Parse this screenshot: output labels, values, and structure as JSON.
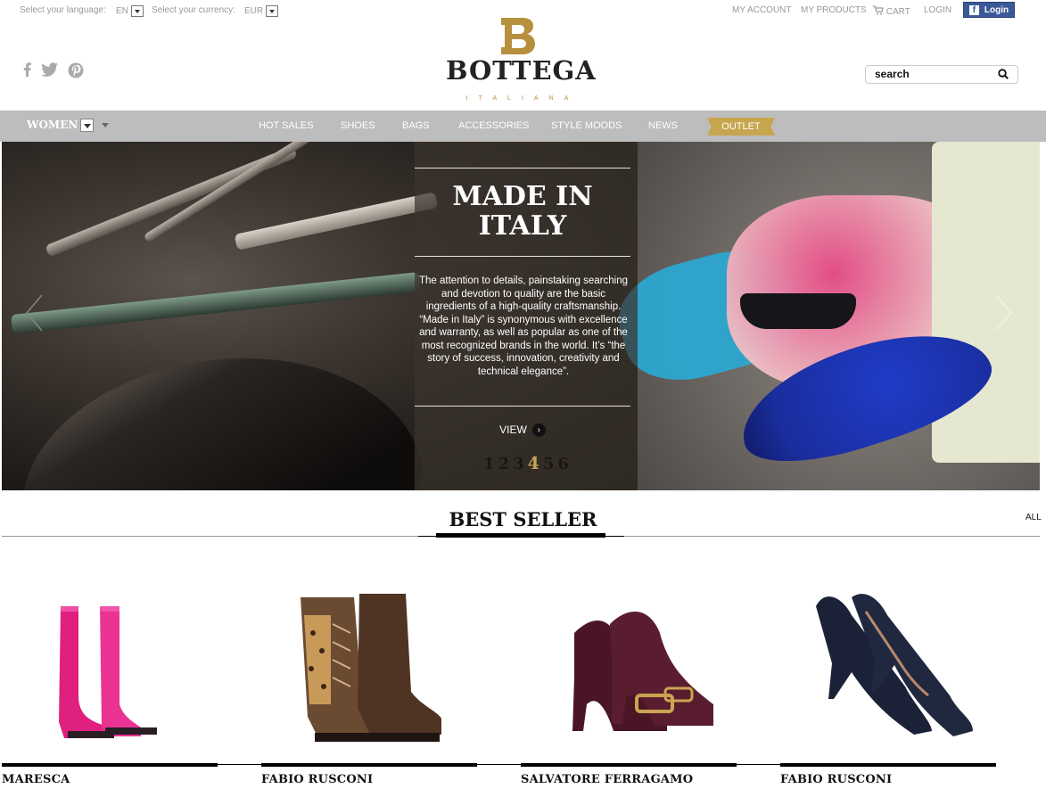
{
  "topbar": {
    "language_label": "Select your language:",
    "language_value": "EN",
    "currency_label": "Select your currency:",
    "currency_value": "EUR",
    "links": [
      "MY ACCOUNT",
      "MY PRODUCTS",
      "CART",
      "LOGIN"
    ],
    "facebook_login": "Login"
  },
  "logo": {
    "name": "BOTTEGA",
    "sub": "ITALIANA"
  },
  "search": {
    "placeholder": "search"
  },
  "nav": {
    "section": "WOMEN",
    "items": [
      "HOT SALES",
      "SHOES",
      "BAGS",
      "ACCESSORIES",
      "STYLE MOODS",
      "NEWS"
    ],
    "outlet": "OUTLET"
  },
  "hero": {
    "title_line1": "MADE IN",
    "title_line2": "ITALY",
    "text": "The attention to details, painstaking searching and devotion to quality are the basic ingredients of a high-quality craftsmanship. “Made in Italy” is synonymous with excellence and warranty, as well as popular as one of the most recognized brands in the world. It’s “the story of success, innovation, creativity and technical elegance”.",
    "view_label": "VIEW",
    "pages": [
      "1",
      "2",
      "3",
      "4",
      "5",
      "6"
    ],
    "active_page": "4"
  },
  "best_seller": {
    "title": "BEST SELLER",
    "all_label": "ALL",
    "products": [
      {
        "brand": "MARESCA",
        "image": "pink-rain-boots"
      },
      {
        "brand": "FABIO RUSCONI",
        "image": "leopard-ankle-boots"
      },
      {
        "brand": "SALVATORE FERRAGAMO",
        "image": "burgundy-pumps"
      },
      {
        "brand": "FABIO RUSCONI",
        "image": "navy-suede-pumps"
      }
    ]
  },
  "colors": {
    "gold": "#c8a54f",
    "nav_bg": "#bdbdbd",
    "facebook": "#3b5998"
  }
}
